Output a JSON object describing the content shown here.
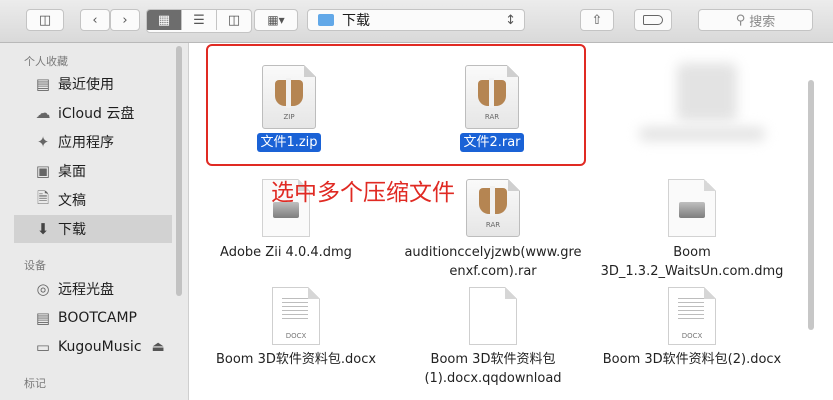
{
  "toolbar": {
    "location": "下载",
    "search_placeholder": "搜索"
  },
  "sidebar": {
    "sections": [
      {
        "title": "个人收藏"
      },
      {
        "title": "设备"
      },
      {
        "title": "标记"
      }
    ],
    "favorites": [
      {
        "label": "最近使用",
        "icon": "recents-icon"
      },
      {
        "label": "iCloud 云盘",
        "icon": "cloud-icon"
      },
      {
        "label": "应用程序",
        "icon": "applications-icon"
      },
      {
        "label": "桌面",
        "icon": "desktop-icon"
      },
      {
        "label": "文稿",
        "icon": "documents-icon"
      },
      {
        "label": "下载",
        "icon": "download-icon",
        "selected": true
      }
    ],
    "devices": [
      {
        "label": "远程光盘",
        "icon": "disc-icon"
      },
      {
        "label": "BOOTCAMP",
        "icon": "disk-icon"
      },
      {
        "label": "KugouMusic",
        "icon": "disk-icon",
        "eject": "⏏"
      }
    ]
  },
  "files": [
    {
      "name": "文件1.zip",
      "type": "ZIP",
      "selected": true
    },
    {
      "name": "文件2.rar",
      "type": "RAR",
      "selected": true
    },
    {
      "name": "Adobe Zii 4.0.4.dmg",
      "type": "dmg"
    },
    {
      "name_line1": "auditionccelyjzwb(www.gre",
      "name_line2": "enxf.com).rar",
      "type": "RAR"
    },
    {
      "name_line1": "Boom",
      "name_line2": "3D_1.3.2_WaitsUn.com.dmg",
      "type": "dmg"
    },
    {
      "name": "Boom 3D软件资料包.docx",
      "type": "DOCX"
    },
    {
      "name_line1": "Boom 3D软件资料包",
      "name_line2": "(1).docx.qqdownload",
      "type": ""
    },
    {
      "name": "Boom 3D软件资料包(2).docx",
      "type": "DOCX"
    }
  ],
  "annotation": {
    "text": "选中多个压缩文件",
    "color": "#e02a23"
  },
  "colors": {
    "selection": "#1a62d6",
    "highlight_box": "#e02a23"
  }
}
